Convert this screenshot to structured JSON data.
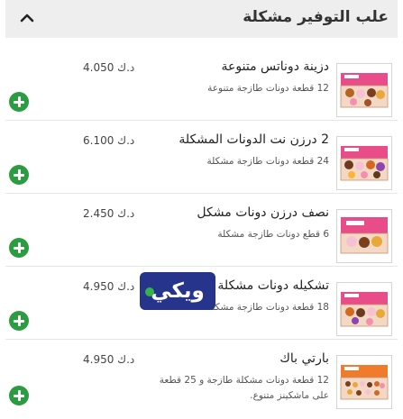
{
  "header": {
    "title": "علب التوفير مشكلة",
    "collapse_icon": "chevron-up-icon"
  },
  "items": [
    {
      "name": "دزينة دوناتس متنوعة",
      "description": "12 قطعة دونات طازجة متنوعة",
      "price": "د.ك 4.050",
      "add_icon": "plus-icon"
    },
    {
      "name": "2 درزن نت الدونات المشكلة",
      "description": "24 قطعة دونات طازجة مشكلة",
      "price": "د.ك 6.100",
      "add_icon": "plus-icon"
    },
    {
      "name": "نصف درزن دونات مشكل",
      "description": "6 قطع دونات طازجة مشكلة",
      "price": "د.ك 2.450",
      "add_icon": "plus-icon"
    },
    {
      "name": "تشكيله دونات مشكلة",
      "description": "18 قطعة دونات طازجة مشكلة",
      "price": "د.ك 4.950",
      "add_icon": "plus-icon"
    },
    {
      "name": "بارتي باك",
      "description": "12 قطعة دونات مشكلة طازجة و 25 قطعة على ماشكينز متنوع.",
      "price": "د.ك 4.950",
      "add_icon": "plus-icon"
    }
  ],
  "watermark": {
    "text": "ويكي"
  },
  "colors": {
    "accent": "#2b9c3f",
    "box_pink": "#e84d8a",
    "box_orange": "#f07b2a",
    "logo": "#27348b"
  }
}
